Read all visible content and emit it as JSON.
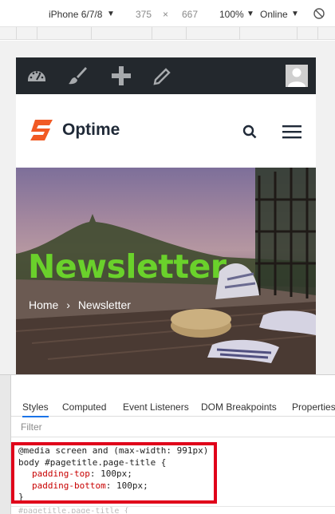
{
  "device_toolbar": {
    "device": "iPhone 6/7/8",
    "width": "375",
    "times": "×",
    "height": "667",
    "zoom": "100%",
    "network": "Online"
  },
  "site": {
    "brand": "Optime",
    "admin_icons": [
      "dashboard-icon",
      "customize-brush-icon",
      "add-new-icon",
      "edit-pencil-icon"
    ],
    "hero_title": "Newsletter",
    "breadcrumb": {
      "home": "Home",
      "separator": "›",
      "current": "Newsletter"
    },
    "colors": {
      "accent_green": "#6ad12b",
      "logo_orange": "#f15a24",
      "admin_bar": "#23282d"
    }
  },
  "devtools": {
    "tabs": [
      "Styles",
      "Computed",
      "Event Listeners",
      "DOM Breakpoints",
      "Properties"
    ],
    "active_tab": "Styles",
    "filter_placeholder": "Filter",
    "css": {
      "media": "@media screen and (max-width: 991px)",
      "selector": "body #pagetitle.page-title {",
      "prop1_name": "padding-top",
      "prop1_value": "100px;",
      "prop2_name": "padding-bottom",
      "prop2_value": "100px;",
      "close": "}"
    },
    "next_rule": "#pagetitle.page-title {"
  }
}
